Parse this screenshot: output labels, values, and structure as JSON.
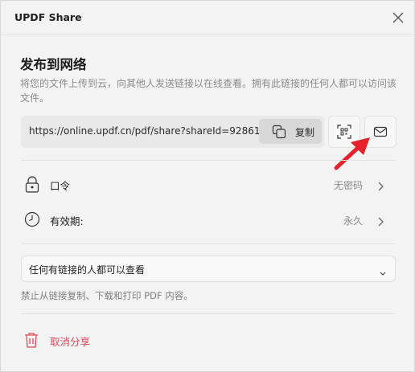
{
  "window": {
    "title": "UPDF Share"
  },
  "publish": {
    "heading": "发布到网络",
    "description": "将您的文件上传到云，向其他人发送链接以在线查看。拥有此链接的任何人都可以访问该文件。",
    "link_url": "https://online.updf.cn/pdf/share?shareId=9286109...",
    "copy_label": "复制"
  },
  "settings": {
    "password": {
      "label": "口令",
      "value": "无密码"
    },
    "validity": {
      "label": "有效期:",
      "value": "永久"
    }
  },
  "access": {
    "selected": "任何有链接的人都可以查看",
    "note": "禁止从链接复制、下载和打印 PDF 内容。"
  },
  "actions": {
    "cancel_share": "取消分享"
  },
  "colors": {
    "danger": "#e2495b",
    "arrow": "#e5222b"
  },
  "icons": [
    "close-icon",
    "copy-icon",
    "qr-code-icon",
    "mail-icon",
    "lock-icon",
    "clock-icon",
    "chevron-right-icon",
    "chevron-down-icon",
    "trash-icon"
  ]
}
